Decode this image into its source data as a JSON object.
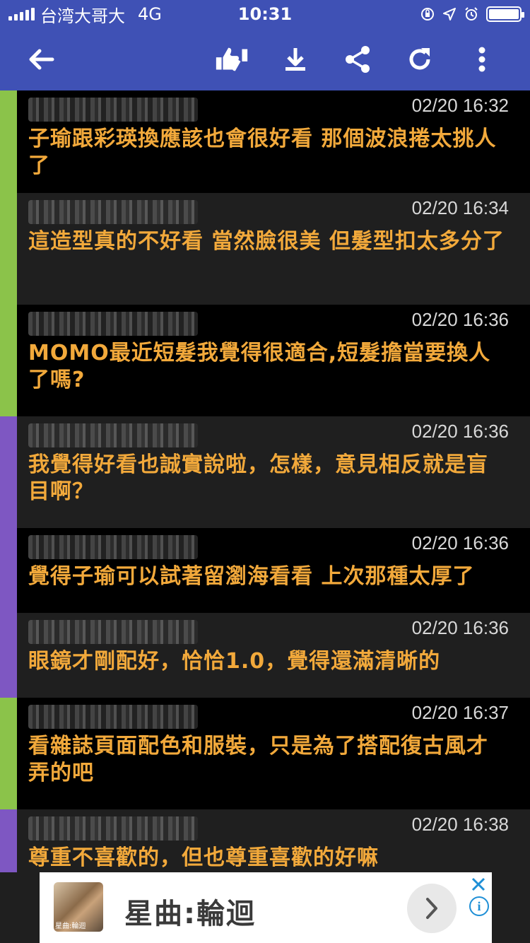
{
  "status_bar": {
    "carrier": "台湾大哥大",
    "network": "4G",
    "time": "10:31",
    "battery_level": 1.0
  },
  "toolbar": {
    "icons": [
      "back-arrow-icon",
      "thumbs-icon",
      "download-icon",
      "share-icon",
      "refresh-icon",
      "more-vert-icon"
    ]
  },
  "comments": [
    {
      "time": "02/20 16:32",
      "text": "子瑜跟彩瑛換應該也會很好看  那個波浪捲太挑人了",
      "bar_color": "#8bc34a",
      "shade": "dark"
    },
    {
      "time": "02/20 16:34",
      "text": "這造型真的不好看 當然臉很美 但髮型扣太多分了",
      "bar_color": "#8bc34a",
      "shade": "grey"
    },
    {
      "time": "02/20 16:36",
      "text": "MOMO最近短髮我覺得很適合,短髮擔當要換人了嗎?",
      "bar_color": "#8bc34a",
      "shade": "dark"
    },
    {
      "time": "02/20 16:36",
      "text": "我覺得好看也誠實說啦，怎樣，意見相反就是盲目啊？",
      "bar_color": "#7e57c2",
      "shade": "grey"
    },
    {
      "time": "02/20 16:36",
      "text": "覺得子瑜可以試著留瀏海看看 上次那種太厚了",
      "bar_color": "#7e57c2",
      "shade": "dark"
    },
    {
      "time": "02/20 16:36",
      "text": "眼鏡才剛配好，恰恰1.0，覺得還滿清晰的",
      "bar_color": "#7e57c2",
      "shade": "grey"
    },
    {
      "time": "02/20 16:37",
      "text": "看雜誌頁面配色和服裝，只是為了搭配復古風才弄的吧",
      "bar_color": "#8bc34a",
      "shade": "dark"
    },
    {
      "time": "02/20 16:38",
      "text": "尊重不喜歡的，但也尊重喜歡的好嘛",
      "bar_color": "#7e57c2",
      "shade": "grey"
    }
  ],
  "ad": {
    "title": "星曲:輪迴",
    "thumb_caption": "星曲:輪迴"
  }
}
